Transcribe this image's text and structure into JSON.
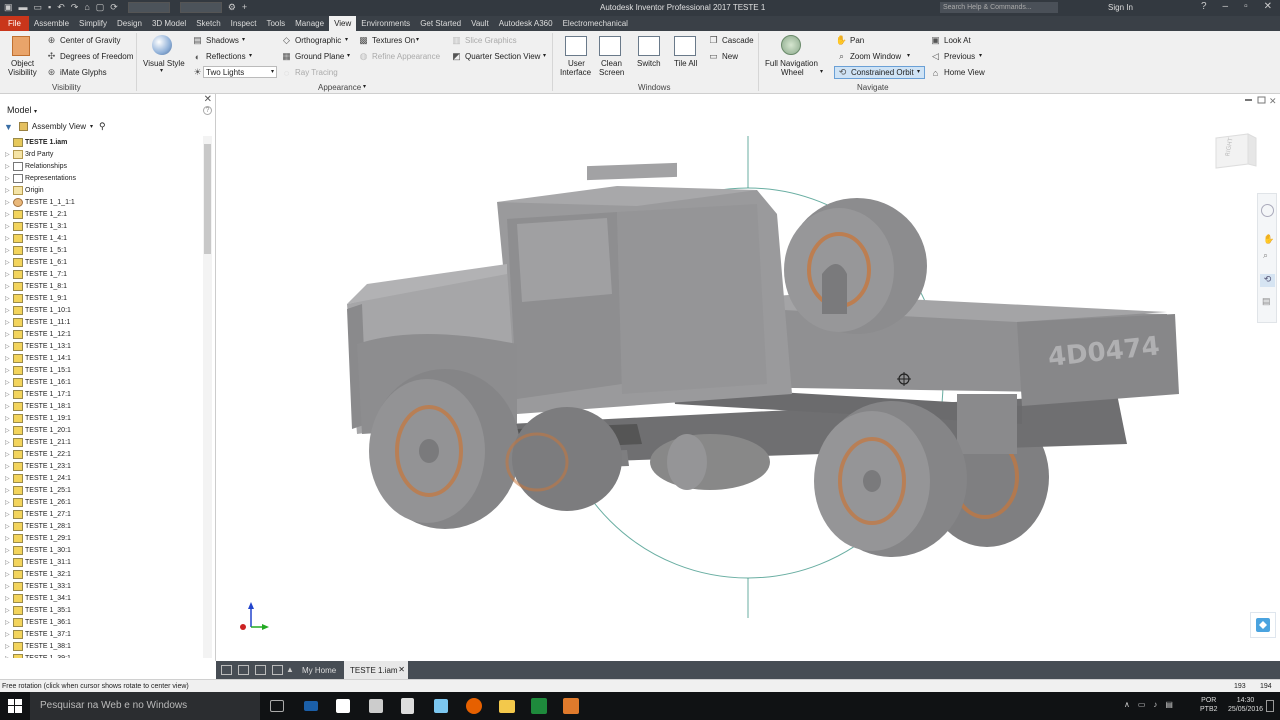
{
  "window": {
    "title": "Autodesk Inventor Professional 2017    TESTE 1",
    "search_placeholder": "Search Help & Commands...",
    "sign_in": "Sign In"
  },
  "tabs": [
    "File",
    "Assemble",
    "Simplify",
    "Design",
    "3D Model",
    "Sketch",
    "Inspect",
    "Tools",
    "Manage",
    "View",
    "Environments",
    "Get Started",
    "Vault",
    "Autodesk A360",
    "Electromechanical"
  ],
  "active_tab": "View",
  "ribbon": {
    "visibility": {
      "object_visibility_1": "Object",
      "object_visibility_2": "Visibility",
      "center_of_gravity": "Center of Gravity",
      "degrees_of_freedom": "Degrees of Freedom",
      "imate_glyphs": "iMate Glyphs",
      "group_label": "Visibility"
    },
    "appearance": {
      "visual_style": "Visual Style",
      "shadows": "Shadows",
      "reflections": "Reflections",
      "lighting_value": "Two Lights",
      "orthographic": "Orthographic",
      "ground_plane": "Ground Plane",
      "ray_tracing": "Ray Tracing",
      "textures_on": "Textures On",
      "refine_appearance": "Refine Appearance",
      "slice_graphics": "Slice Graphics",
      "quarter_section_view": "Quarter Section View",
      "group_label": "Appearance"
    },
    "windows": {
      "user_interface_1": "User",
      "user_interface_2": "Interface",
      "clean_screen_1": "Clean",
      "clean_screen_2": "Screen",
      "switch": "Switch",
      "tile_all": "Tile All",
      "cascade": "Cascade",
      "new": "New",
      "group_label": "Windows"
    },
    "navigate": {
      "full_nav_wheel_1": "Full Navigation",
      "full_nav_wheel_2": "Wheel",
      "pan": "Pan",
      "zoom_window": "Zoom Window",
      "constrained_orbit": "Constrained Orbit",
      "look_at": "Look At",
      "previous": "Previous",
      "home_view": "Home View",
      "group_label": "Navigate"
    }
  },
  "browser": {
    "title": "Model",
    "view_mode": "Assembly View",
    "items": [
      {
        "label": "TESTE 1.iam",
        "type": "root"
      },
      {
        "label": "3rd Party",
        "type": "folder"
      },
      {
        "label": "Relationships",
        "type": "rel"
      },
      {
        "label": "Representations",
        "type": "rel"
      },
      {
        "label": "Origin",
        "type": "folder"
      },
      {
        "label": "TESTE 1_1_1:1",
        "type": "part"
      },
      {
        "label": "TESTE 1_2:1",
        "type": "asm"
      },
      {
        "label": "TESTE 1_3:1",
        "type": "asm"
      },
      {
        "label": "TESTE 1_4:1",
        "type": "asm"
      },
      {
        "label": "TESTE 1_5:1",
        "type": "asm"
      },
      {
        "label": "TESTE 1_6:1",
        "type": "asm"
      },
      {
        "label": "TESTE 1_7:1",
        "type": "asm"
      },
      {
        "label": "TESTE 1_8:1",
        "type": "asm"
      },
      {
        "label": "TESTE 1_9:1",
        "type": "asm"
      },
      {
        "label": "TESTE 1_10:1",
        "type": "asm"
      },
      {
        "label": "TESTE 1_11:1",
        "type": "asm"
      },
      {
        "label": "TESTE 1_12:1",
        "type": "asm"
      },
      {
        "label": "TESTE 1_13:1",
        "type": "asm"
      },
      {
        "label": "TESTE 1_14:1",
        "type": "asm"
      },
      {
        "label": "TESTE 1_15:1",
        "type": "asm"
      },
      {
        "label": "TESTE 1_16:1",
        "type": "asm"
      },
      {
        "label": "TESTE 1_17:1",
        "type": "asm"
      },
      {
        "label": "TESTE 1_18:1",
        "type": "asm"
      },
      {
        "label": "TESTE 1_19:1",
        "type": "asm"
      },
      {
        "label": "TESTE 1_20:1",
        "type": "asm"
      },
      {
        "label": "TESTE 1_21:1",
        "type": "asm"
      },
      {
        "label": "TESTE 1_22:1",
        "type": "asm"
      },
      {
        "label": "TESTE 1_23:1",
        "type": "asm"
      },
      {
        "label": "TESTE 1_24:1",
        "type": "asm"
      },
      {
        "label": "TESTE 1_25:1",
        "type": "asm"
      },
      {
        "label": "TESTE 1_26:1",
        "type": "asm"
      },
      {
        "label": "TESTE 1_27:1",
        "type": "asm"
      },
      {
        "label": "TESTE 1_28:1",
        "type": "asm"
      },
      {
        "label": "TESTE 1_29:1",
        "type": "asm"
      },
      {
        "label": "TESTE 1_30:1",
        "type": "asm"
      },
      {
        "label": "TESTE 1_31:1",
        "type": "asm"
      },
      {
        "label": "TESTE 1_32:1",
        "type": "asm"
      },
      {
        "label": "TESTE 1_33:1",
        "type": "asm"
      },
      {
        "label": "TESTE 1_34:1",
        "type": "asm"
      },
      {
        "label": "TESTE 1_35:1",
        "type": "asm"
      },
      {
        "label": "TESTE 1_36:1",
        "type": "asm"
      },
      {
        "label": "TESTE 1_37:1",
        "type": "asm"
      },
      {
        "label": "TESTE 1_38:1",
        "type": "asm"
      },
      {
        "label": "TESTE 1_39:1",
        "type": "asm"
      }
    ]
  },
  "viewport": {
    "viewcube_label": "RIGHT",
    "plate_text": "4D0474"
  },
  "doc_tabs": {
    "home": "My Home",
    "active": "TESTE 1.iam"
  },
  "status": {
    "message": "Free rotation (click when cursor shows rotate to center view)",
    "num1": "193",
    "num2": "194"
  },
  "taskbar": {
    "search": "Pesquisar na Web e no Windows",
    "lang1": "POR",
    "lang2": "PTB2",
    "time": "14:30",
    "date": "25/05/2016"
  },
  "colors": {
    "file_tab": "#c9361b",
    "ribbon_bg": "#f0f0f0",
    "model_gray": "#8c8c8e",
    "rim_orange": "#c8763a",
    "orbit_teal": "#2a8c7a"
  }
}
